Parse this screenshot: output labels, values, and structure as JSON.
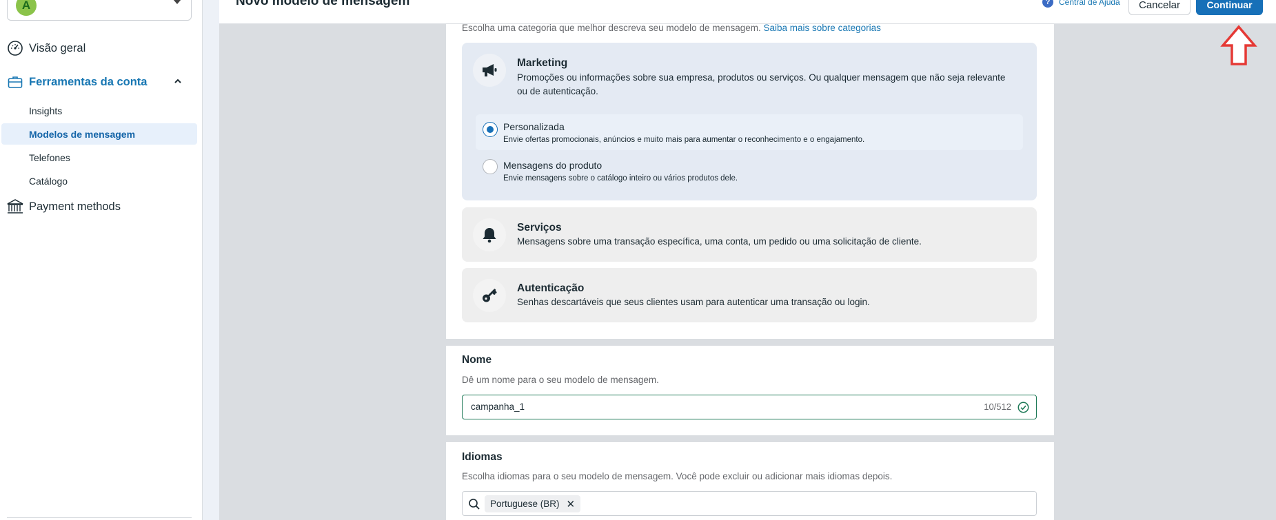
{
  "sidebar": {
    "account_initial": "A",
    "account_name": "",
    "nav": {
      "overview": "Visão geral",
      "account_tools": "Ferramentas da conta",
      "insights": "Insights",
      "message_templates": "Modelos de mensagem",
      "phones": "Telefones",
      "catalog": "Catálogo",
      "payment_methods": "Payment methods"
    }
  },
  "header": {
    "title": "Novo modelo de mensagem",
    "help": "Central de Ajuda",
    "cancel": "Cancelar",
    "continue": "Continuar"
  },
  "category": {
    "description": "Escolha uma categoria que melhor descreva seu modelo de mensagem.",
    "learn_more": "Saiba mais sobre categorias",
    "marketing": {
      "title": "Marketing",
      "text_line1": "Promoções ou informações sobre sua empresa, produtos ou serviços. Ou qualquer mensagem que não seja relevante",
      "text_line2": "ou de autenticação.",
      "options": [
        {
          "title": "Personalizada",
          "desc": "Envie ofertas promocionais, anúncios e muito mais para aumentar o reconhecimento e o engajamento.",
          "selected": true
        },
        {
          "title": "Mensagens do produto",
          "desc": "Envie mensagens sobre o catálogo inteiro ou vários produtos dele.",
          "selected": false
        }
      ]
    },
    "services": {
      "title": "Serviços",
      "text": "Mensagens sobre uma transação específica, uma conta, um pedido ou uma solicitação de cliente."
    },
    "auth": {
      "title": "Autenticação",
      "text": "Senhas descartáveis que seus clientes usam para autenticar uma transação ou login."
    }
  },
  "name_section": {
    "title": "Nome",
    "desc": "Dê um nome para o seu modelo de mensagem.",
    "value": "campanha_1",
    "counter": "10/512"
  },
  "languages_section": {
    "title": "Idiomas",
    "desc": "Escolha idiomas para o seu modelo de mensagem. Você pode excluir ou adicionar mais idiomas depois.",
    "chip": "Portuguese (BR)"
  },
  "colors": {
    "accent": "#1770b8",
    "selected_card": "#e4eaf3",
    "annotation_arrow": "#e53935"
  }
}
